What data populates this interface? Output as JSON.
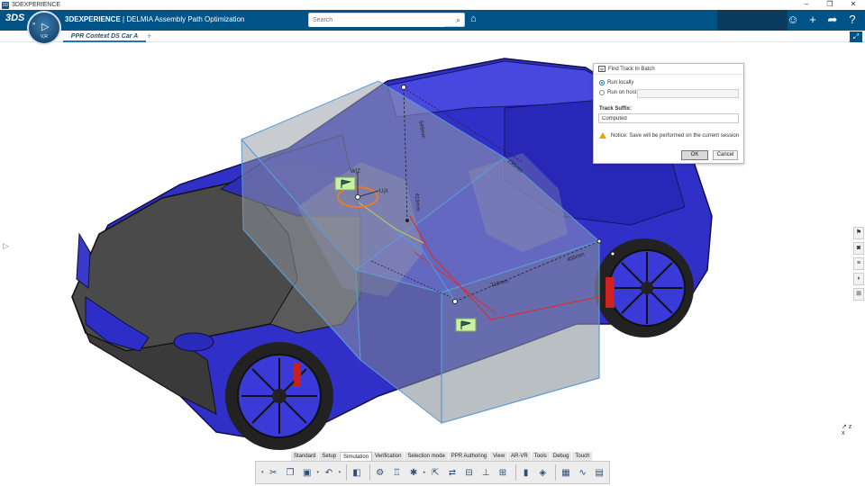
{
  "os": {
    "title": "3DEXPERIENCE",
    "controls": [
      "–",
      "❐",
      "✕"
    ]
  },
  "header": {
    "brand": "3DEXPERIENCE",
    "app_name": " | DELMIA Assembly Path Optimization",
    "search_placeholder": "Search",
    "compass_label": "V,R",
    "icons": [
      "user-icon",
      "plus-icon",
      "share-icon",
      "help-icon"
    ]
  },
  "tabs": [
    {
      "label": "PPR Context DS Car A",
      "active": true
    }
  ],
  "viewport": {
    "labels": {
      "w": "W|Z",
      "u": "U|X",
      "dim_549": "549mm",
      "dim_419": "419mm",
      "dim_718": "718mm",
      "dim_455": "455mm",
      "dim_235": "235mm"
    },
    "colors": {
      "car_body": "#2e2ed0",
      "hood": "#4c4c4c",
      "box_face": "#8c949c",
      "box_edge": "#5a9ad8",
      "path_red": "#d63030",
      "flag_bg": "#c9f1a4"
    }
  },
  "dialog": {
    "title": "Find Track In Batch",
    "run_locally": "Run locally",
    "run_on_host": "Run on host",
    "selected": "run_locally",
    "host_value": "",
    "track_suffix_label": "Track Suffix:",
    "track_suffix_value": "Computed",
    "notice": "Notice: Save will be performed on the current session",
    "ok": "OK",
    "cancel": "Cancel"
  },
  "toolbar": {
    "tabs": [
      "Standard",
      "Setup",
      "Simulation",
      "Verification",
      "Selection mode",
      "PPR Authoring",
      "View",
      "AR-VR",
      "Tools",
      "Debug",
      "Touch"
    ],
    "active_tab": "Simulation",
    "tools": [
      "cut-icon",
      "copy-icon",
      "paste-icon",
      "undo-icon",
      "track-icon",
      "mechanism-icon",
      "robot-icon",
      "manikin-icon",
      "move-icon",
      "path-icon",
      "measure-icon",
      "clash-icon",
      "section-icon",
      "compute-icon",
      "analysis-icon",
      "chart-icon",
      "monitor-icon"
    ]
  },
  "compass_axis": "z\nx"
}
